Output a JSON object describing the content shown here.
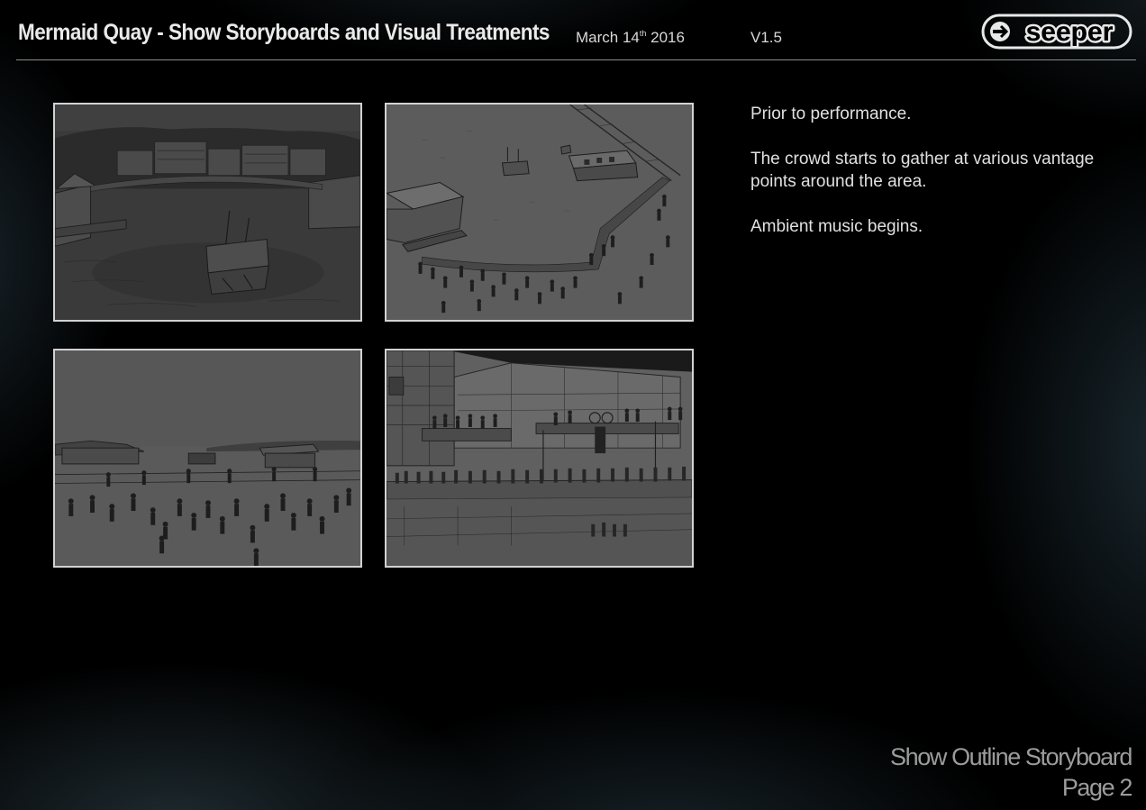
{
  "header": {
    "title": "Mermaid Quay - Show Storyboards and Visual Treatments",
    "date_prefix": "March 14",
    "date_suffix": "th",
    "date_year": " 2016",
    "version": "V1.5",
    "logo_text": "seeper"
  },
  "storyboard": {
    "panels": [
      {
        "subject": "quay-waterfront-night"
      },
      {
        "subject": "crowd-gathering-aerial"
      },
      {
        "subject": "crowd-on-promenade"
      },
      {
        "subject": "spectators-on-balconies"
      }
    ]
  },
  "notes": [
    "Prior to performance.",
    "The crowd starts to gather at various vantage points around the area.",
    "Ambient music begins."
  ],
  "footer": {
    "section": "Show Outline Storyboard",
    "page": "Page 2"
  },
  "colors": {
    "background": "#000000",
    "panel_border": "#d2d2d2",
    "sketch_fill": "#5a5a5a"
  }
}
